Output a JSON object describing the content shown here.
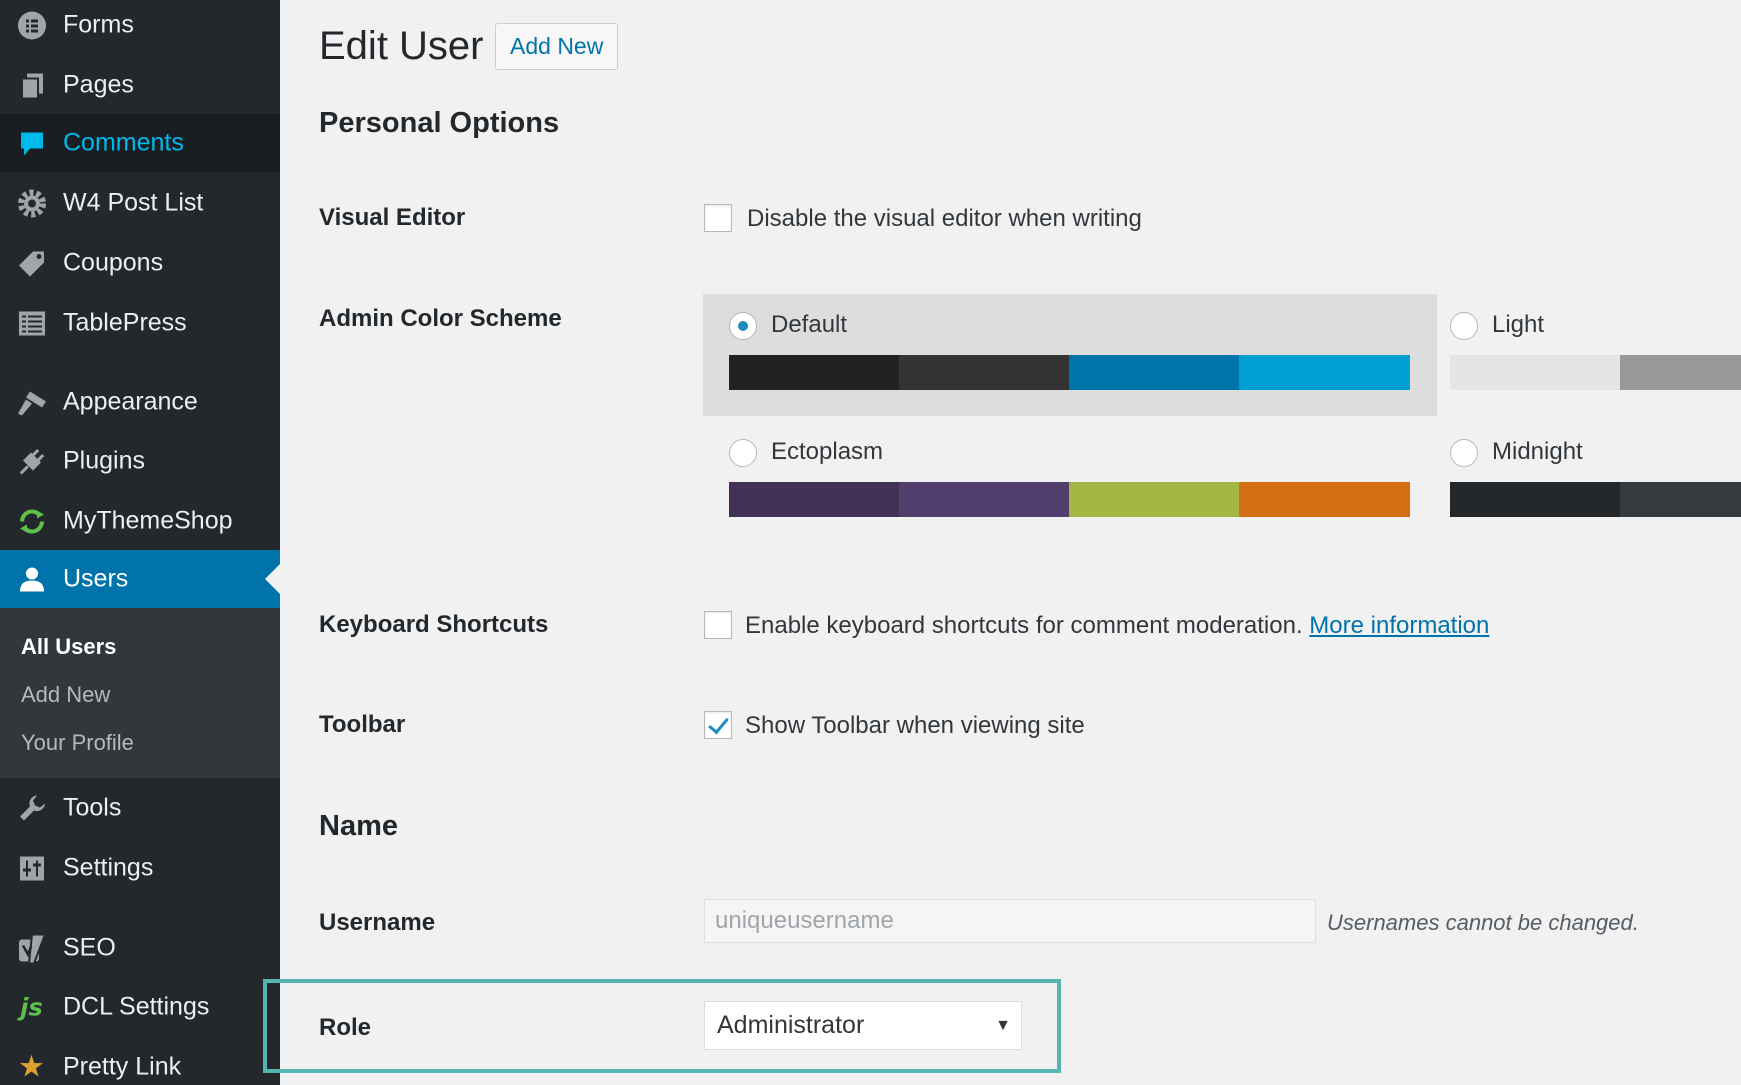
{
  "sidebar": {
    "items": [
      {
        "label": "Forms",
        "icon": "forms-icon"
      },
      {
        "label": "Pages",
        "icon": "pages-icon"
      },
      {
        "label": "Comments",
        "icon": "comments-icon"
      },
      {
        "label": "W4 Post List",
        "icon": "gear-icon"
      },
      {
        "label": "Coupons",
        "icon": "tag-icon"
      },
      {
        "label": "TablePress",
        "icon": "table-icon"
      },
      {
        "label": "Appearance",
        "icon": "paintbrush-icon"
      },
      {
        "label": "Plugins",
        "icon": "plugin-icon"
      },
      {
        "label": "MyThemeShop",
        "icon": "refresh-icon"
      },
      {
        "label": "Users",
        "icon": "user-icon"
      },
      {
        "label": "Tools",
        "icon": "wrench-icon"
      },
      {
        "label": "Settings",
        "icon": "settings-icon"
      },
      {
        "label": "SEO",
        "icon": "yoast-icon"
      },
      {
        "label": "DCL Settings",
        "icon": "js-icon"
      },
      {
        "label": "Pretty Link",
        "icon": "star-icon"
      }
    ],
    "submenu": [
      "All Users",
      "Add New",
      "Your Profile"
    ]
  },
  "header": {
    "title": "Edit User",
    "add_new": "Add New"
  },
  "personal_options": {
    "heading": "Personal Options",
    "visual_editor": {
      "label": "Visual Editor",
      "option": "Disable the visual editor when writing",
      "checked": false
    },
    "color_scheme": {
      "label": "Admin Color Scheme",
      "schemes": [
        {
          "name": "Default",
          "selected": true,
          "colors": [
            "#222222",
            "#333333",
            "#0073aa",
            "#00a0d2"
          ]
        },
        {
          "name": "Light",
          "selected": false,
          "colors": [
            "#e5e5e5",
            "#999999"
          ]
        },
        {
          "name": "Ectoplasm",
          "selected": false,
          "colors": [
            "#413256",
            "#523f6d",
            "#a3b745",
            "#d46f15"
          ]
        },
        {
          "name": "Midnight",
          "selected": false,
          "colors": [
            "#25282b",
            "#363b3f"
          ]
        }
      ]
    },
    "keyboard_shortcuts": {
      "label": "Keyboard Shortcuts",
      "option": "Enable keyboard shortcuts for comment moderation.",
      "link": "More information",
      "checked": false
    },
    "toolbar": {
      "label": "Toolbar",
      "option": "Show Toolbar when viewing site",
      "checked": true
    }
  },
  "name_section": {
    "heading": "Name",
    "username": {
      "label": "Username",
      "value": "uniqueusername",
      "note": "Usernames cannot be changed."
    },
    "role": {
      "label": "Role",
      "value": "Administrator",
      "arrow": "▼"
    }
  },
  "colors": {
    "sidebar_bg": "#23282d",
    "accent": "#0073aa",
    "highlight": "#56b5b0"
  }
}
